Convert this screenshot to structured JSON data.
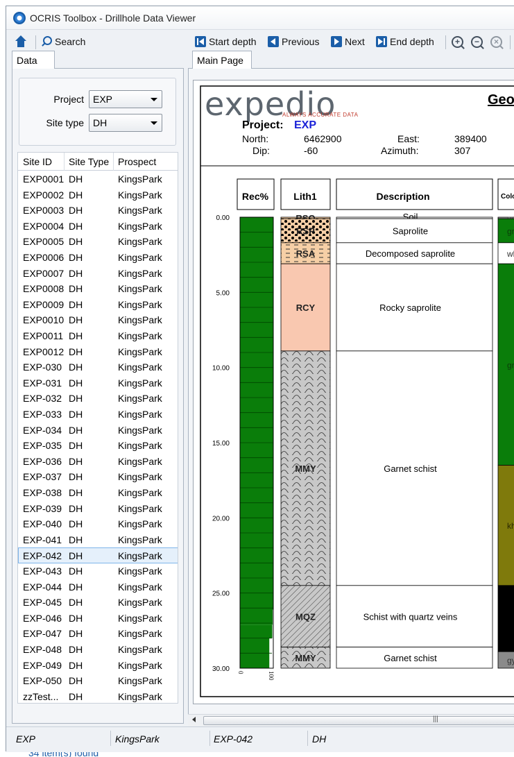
{
  "window": {
    "title": "OCRIS Toolbox - Drillhole Data Viewer"
  },
  "left_toolbar": {
    "search_label": "Search"
  },
  "left_tabs": [
    {
      "label": "Data"
    }
  ],
  "filters": {
    "project_label": "Project",
    "project_value": "EXP",
    "site_type_label": "Site type",
    "site_type_value": "DH"
  },
  "site_grid": {
    "columns": [
      "Site ID",
      "Site Type",
      "Prospect"
    ],
    "rows": [
      [
        "EXP0001",
        "DH",
        "KingsPark"
      ],
      [
        "EXP0002",
        "DH",
        "KingsPark"
      ],
      [
        "EXP0003",
        "DH",
        "KingsPark"
      ],
      [
        "EXP0004",
        "DH",
        "KingsPark"
      ],
      [
        "EXP0005",
        "DH",
        "KingsPark"
      ],
      [
        "EXP0006",
        "DH",
        "KingsPark"
      ],
      [
        "EXP0007",
        "DH",
        "KingsPark"
      ],
      [
        "EXP0008",
        "DH",
        "KingsPark"
      ],
      [
        "EXP0009",
        "DH",
        "KingsPark"
      ],
      [
        "EXP0010",
        "DH",
        "KingsPark"
      ],
      [
        "EXP0011",
        "DH",
        "KingsPark"
      ],
      [
        "EXP0012",
        "DH",
        "KingsPark"
      ],
      [
        "EXP-030",
        "DH",
        "KingsPark"
      ],
      [
        "EXP-031",
        "DH",
        "KingsPark"
      ],
      [
        "EXP-032",
        "DH",
        "KingsPark"
      ],
      [
        "EXP-033",
        "DH",
        "KingsPark"
      ],
      [
        "EXP-034",
        "DH",
        "KingsPark"
      ],
      [
        "EXP-035",
        "DH",
        "KingsPark"
      ],
      [
        "EXP-036",
        "DH",
        "KingsPark"
      ],
      [
        "EXP-037",
        "DH",
        "KingsPark"
      ],
      [
        "EXP-038",
        "DH",
        "KingsPark"
      ],
      [
        "EXP-039",
        "DH",
        "KingsPark"
      ],
      [
        "EXP-040",
        "DH",
        "KingsPark"
      ],
      [
        "EXP-041",
        "DH",
        "KingsPark"
      ],
      [
        "EXP-042",
        "DH",
        "KingsPark"
      ],
      [
        "EXP-043",
        "DH",
        "KingsPark"
      ],
      [
        "EXP-044",
        "DH",
        "KingsPark"
      ],
      [
        "EXP-045",
        "DH",
        "KingsPark"
      ],
      [
        "EXP-046",
        "DH",
        "KingsPark"
      ],
      [
        "EXP-047",
        "DH",
        "KingsPark"
      ],
      [
        "EXP-048",
        "DH",
        "KingsPark"
      ],
      [
        "EXP-049",
        "DH",
        "KingsPark"
      ],
      [
        "EXP-050",
        "DH",
        "KingsPark"
      ],
      [
        "zzTest...",
        "DH",
        "KingsPark"
      ]
    ],
    "selected_site": "EXP-042",
    "found_text": "34 item(s) found"
  },
  "right_toolbar": {
    "start_label": "Start depth",
    "previous_label": "Previous",
    "next_label": "Next",
    "end_label": "End depth"
  },
  "right_tabs": [
    {
      "label": "Main Page"
    }
  ],
  "report": {
    "logo_text": "expedio",
    "logo_tagline": "ALWAYS ACCURATE DATA",
    "heading_partial": "Geo",
    "project_label": "Project:",
    "project_value": "EXP",
    "north_label": "North:",
    "north_value": "6462900",
    "east_label": "East:",
    "east_value": "389400",
    "dip_label": "Dip:",
    "dip_value": "-60",
    "azimuth_label": "Azimuth:",
    "azimuth_value": "307",
    "columns": {
      "rec": "Rec%",
      "lith": "Lith1",
      "desc": "Description",
      "colour": "Colo"
    },
    "depth_ticks": [
      "0.00",
      "5.00",
      "10.00",
      "15.00",
      "20.00",
      "25.00",
      "30.00"
    ],
    "rec_axis_labels": [
      "0",
      "100"
    ],
    "accent_project": "#1a22d8",
    "rec_color": "#0a7d0a"
  },
  "log_intervals": {
    "lithology": [
      {
        "code": "RSO",
        "from": 0.0,
        "to": 0.1,
        "color": "#f6cfa6",
        "pattern": "none"
      },
      {
        "code": "RSP",
        "from": 0.1,
        "to": 1.7,
        "color": "#f6cfa6",
        "pattern": "dots"
      },
      {
        "code": "RSA",
        "from": 1.7,
        "to": 3.1,
        "color": "#f6cfa6",
        "pattern": "dash"
      },
      {
        "code": "RCY",
        "from": 3.1,
        "to": 8.9,
        "color": "#f9c8b0",
        "pattern": "none"
      },
      {
        "code": "MMY",
        "from": 8.9,
        "to": 24.5,
        "color": "#c8c8c8",
        "pattern": "wave"
      },
      {
        "code": "MQZ",
        "from": 24.5,
        "to": 28.6,
        "color": "#c8c8c8",
        "pattern": "hatch"
      },
      {
        "code": "MMY",
        "from": 28.6,
        "to": 30.0,
        "color": "#c8c8c8",
        "pattern": "wave"
      }
    ],
    "descriptions": [
      {
        "text": "Soil",
        "from": 0.0,
        "to": 0.1
      },
      {
        "text": "Saprolite",
        "from": 0.1,
        "to": 1.7
      },
      {
        "text": "Decomposed saprolite",
        "from": 1.7,
        "to": 3.1
      },
      {
        "text": "Rocky saprolite",
        "from": 3.1,
        "to": 8.9
      },
      {
        "text": "Garnet schist",
        "from": 8.9,
        "to": 24.5
      },
      {
        "text": "Schist with quartz veins",
        "from": 24.5,
        "to": 28.6
      },
      {
        "text": "Garnet schist",
        "from": 28.6,
        "to": 30.0
      }
    ],
    "colours": [
      {
        "text": "gy",
        "from": 0.0,
        "to": 0.1,
        "color": "#9e9e9e",
        "label_color": "#555555"
      },
      {
        "text": "gr",
        "from": 0.1,
        "to": 1.7,
        "color": "#0a7d0a",
        "label_color": "#0a3a0a"
      },
      {
        "text": "wh",
        "from": 1.7,
        "to": 3.1,
        "color": "#ffffff",
        "label_color": "#333333"
      },
      {
        "text": "gr",
        "from": 3.1,
        "to": 16.5,
        "color": "#0a7d0a",
        "label_color": "#0a3a0a"
      },
      {
        "text": "kh",
        "from": 16.5,
        "to": 24.5,
        "color": "#7f7a0c",
        "label_color": "#2a2800"
      },
      {
        "text": "",
        "from": 24.5,
        "to": 28.9,
        "color": "#000000",
        "label_color": "#ffffff"
      },
      {
        "text": "gy",
        "from": 28.9,
        "to": 30.0,
        "color": "#8a8a8a",
        "label_color": "#333333"
      }
    ],
    "recovery_pct": [
      {
        "from": 0.0,
        "to": 26.1,
        "value": 100
      },
      {
        "from": 26.1,
        "to": 27.1,
        "value": 98
      },
      {
        "from": 27.1,
        "to": 28.0,
        "value": 97
      },
      {
        "from": 28.0,
        "to": 30.0,
        "value": 88
      }
    ]
  },
  "statusbar": {
    "project": "EXP",
    "prospect": "KingsPark",
    "site": "EXP-042",
    "site_type": "DH"
  }
}
